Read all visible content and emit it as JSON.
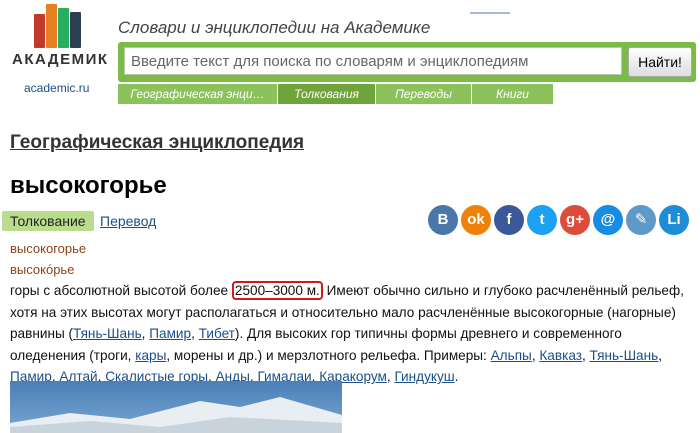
{
  "header": {
    "logo_word": "АКАДЕМИК",
    "logo_sub": "academic.ru",
    "tagline": "Словари и энциклопедии на Академике",
    "search_placeholder": "Введите текст для поиска по словарям и энциклопедиям",
    "search_button": "Найти!",
    "tabs": [
      {
        "label": "Географическая энци…"
      },
      {
        "label": "Толкования"
      },
      {
        "label": "Переводы"
      },
      {
        "label": "Книги"
      }
    ]
  },
  "article": {
    "dictionary_title": "Географическая энциклопедия",
    "headword": "высокогорье",
    "tab_tolkovanie": "Толкование",
    "link_perevod": "Перевод",
    "form1": "высокогорье",
    "form2": "высоко́рье",
    "text": {
      "p1": "горы с абсолютной высотой более ",
      "highlight": "2500–3000 м.",
      "p2": " Имеют обычно сильно и глубоко расчленённый рельеф, хотя на этих высотах могут располагаться и относительно мало расчленённые высокогорные (нагорные) равнины (",
      "l1": "Тянь-Шань",
      "l2": "Памир",
      "l3": "Тибет",
      "p3": "). Для высоких гор типичны формы древнего и современного оледенения (троги, ",
      "l4": "кары",
      "p4": ", морены и др.) и мерзлотного рельефа. Примеры: ",
      "l5": "Альпы",
      "l6": "Кавказ",
      "l7": "Тянь-Шань",
      "l8": "Памир",
      "l9": "Алтай",
      "l10": "Скалистые горы",
      "l11": "Анды",
      "l12": "Гималаи",
      "l13": "Каракорум",
      "l14": "Гиндукуш"
    }
  },
  "share_icons": [
    {
      "name": "vk-icon",
      "glyph": "B",
      "color": "#4a76a8"
    },
    {
      "name": "odnoklassniki-icon",
      "glyph": "ok",
      "color": "#ee8208"
    },
    {
      "name": "facebook-icon",
      "glyph": "f",
      "color": "#3b5998"
    },
    {
      "name": "twitter-icon",
      "glyph": "t",
      "color": "#1da1f2"
    },
    {
      "name": "google-plus-icon",
      "glyph": "g+",
      "color": "#dd4b39"
    },
    {
      "name": "mail-icon",
      "glyph": "@",
      "color": "#168de2"
    },
    {
      "name": "livejournal-icon",
      "glyph": "✎",
      "color": "#5e99c8"
    },
    {
      "name": "liveinternet-icon",
      "glyph": "Li",
      "color": "#1f8dd6"
    }
  ]
}
